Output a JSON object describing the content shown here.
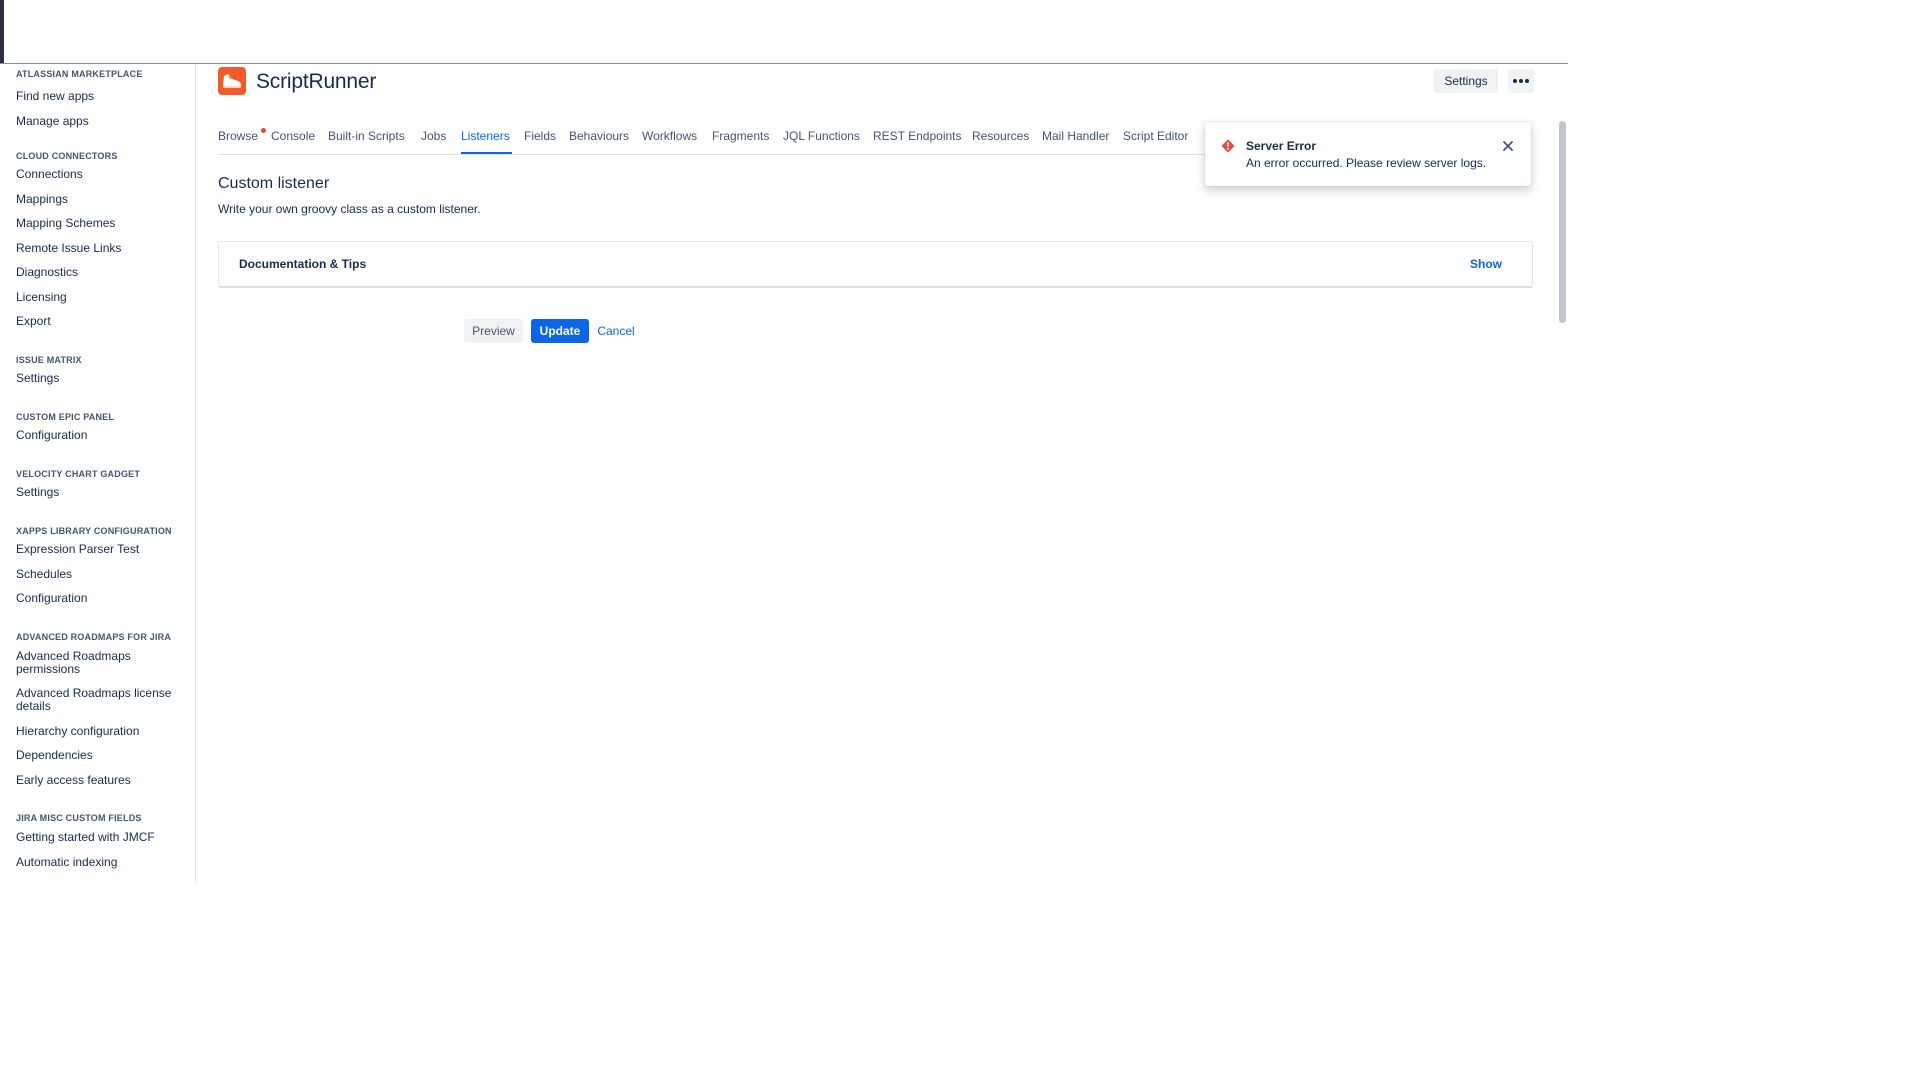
{
  "app": {
    "title": "ScriptRunner",
    "settings_label": "Settings"
  },
  "sidebar": {
    "sections": [
      {
        "heading": "ATLASSIAN MARKETPLACE",
        "items": [
          "Find new apps",
          "Manage apps"
        ]
      },
      {
        "heading": "CLOUD CONNECTORS",
        "items": [
          "Connections",
          "Mappings",
          "Mapping Schemes",
          "Remote Issue Links",
          "Diagnostics",
          "Licensing",
          "Export"
        ]
      },
      {
        "heading": "ISSUE MATRIX",
        "items": [
          "Settings"
        ]
      },
      {
        "heading": "CUSTOM EPIC PANEL",
        "items": [
          "Configuration"
        ]
      },
      {
        "heading": "VELOCITY CHART GADGET",
        "items": [
          "Settings"
        ]
      },
      {
        "heading": "XAPPS LIBRARY CONFIGURATION",
        "items": [
          "Expression Parser Test",
          "Schedules",
          "Configuration"
        ]
      },
      {
        "heading": "ADVANCED ROADMAPS FOR JIRA",
        "items": [
          "Advanced Roadmaps permissions",
          "Advanced Roadmaps license details",
          "Hierarchy configuration",
          "Dependencies",
          "Early access features"
        ]
      },
      {
        "heading": "JIRA MISC CUSTOM FIELDS",
        "items": [
          "Getting started with JMCF",
          "Automatic indexing"
        ]
      }
    ]
  },
  "tabs": [
    "Browse",
    "Console",
    "Built-in Scripts",
    "Jobs",
    "Listeners",
    "Fields",
    "Behaviours",
    "Workflows",
    "Fragments",
    "JQL Functions",
    "REST Endpoints",
    "Resources",
    "Mail Handler",
    "Script Editor"
  ],
  "active_tab": "Listeners",
  "page": {
    "title": "Custom listener",
    "description": "Write your own groovy class as a custom listener."
  },
  "doc_panel": {
    "title": "Documentation & Tips",
    "toggle_label": "Show"
  },
  "actions": {
    "preview": "Preview",
    "update": "Update",
    "cancel": "Cancel"
  },
  "toast": {
    "title": "Server Error",
    "message": "An error occurred. Please review server logs."
  },
  "colors": {
    "accent": "#0c66e4",
    "brand": "#f15b2a",
    "error": "#e2483d"
  }
}
